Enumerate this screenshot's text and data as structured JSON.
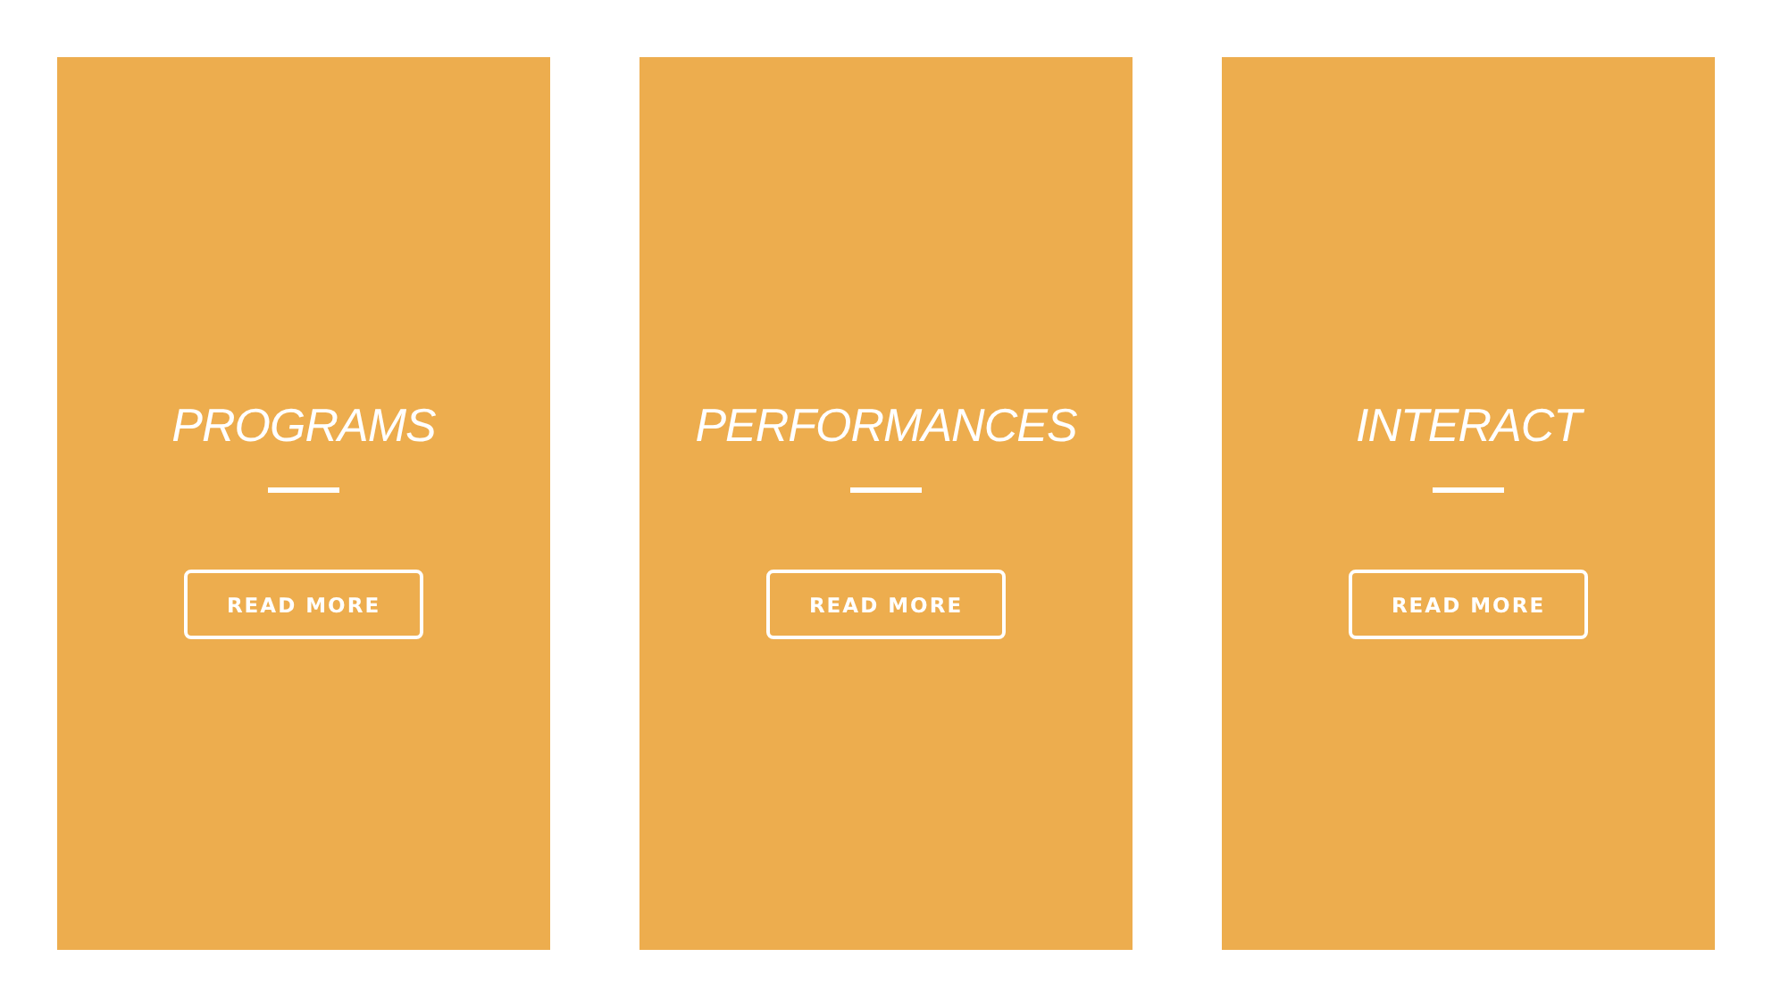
{
  "cards": [
    {
      "title": "PROGRAMS",
      "button": "READ MORE"
    },
    {
      "title": "PERFORMANCES",
      "button": "READ MORE"
    },
    {
      "title": "INTERACT",
      "button": "READ MORE"
    }
  ]
}
